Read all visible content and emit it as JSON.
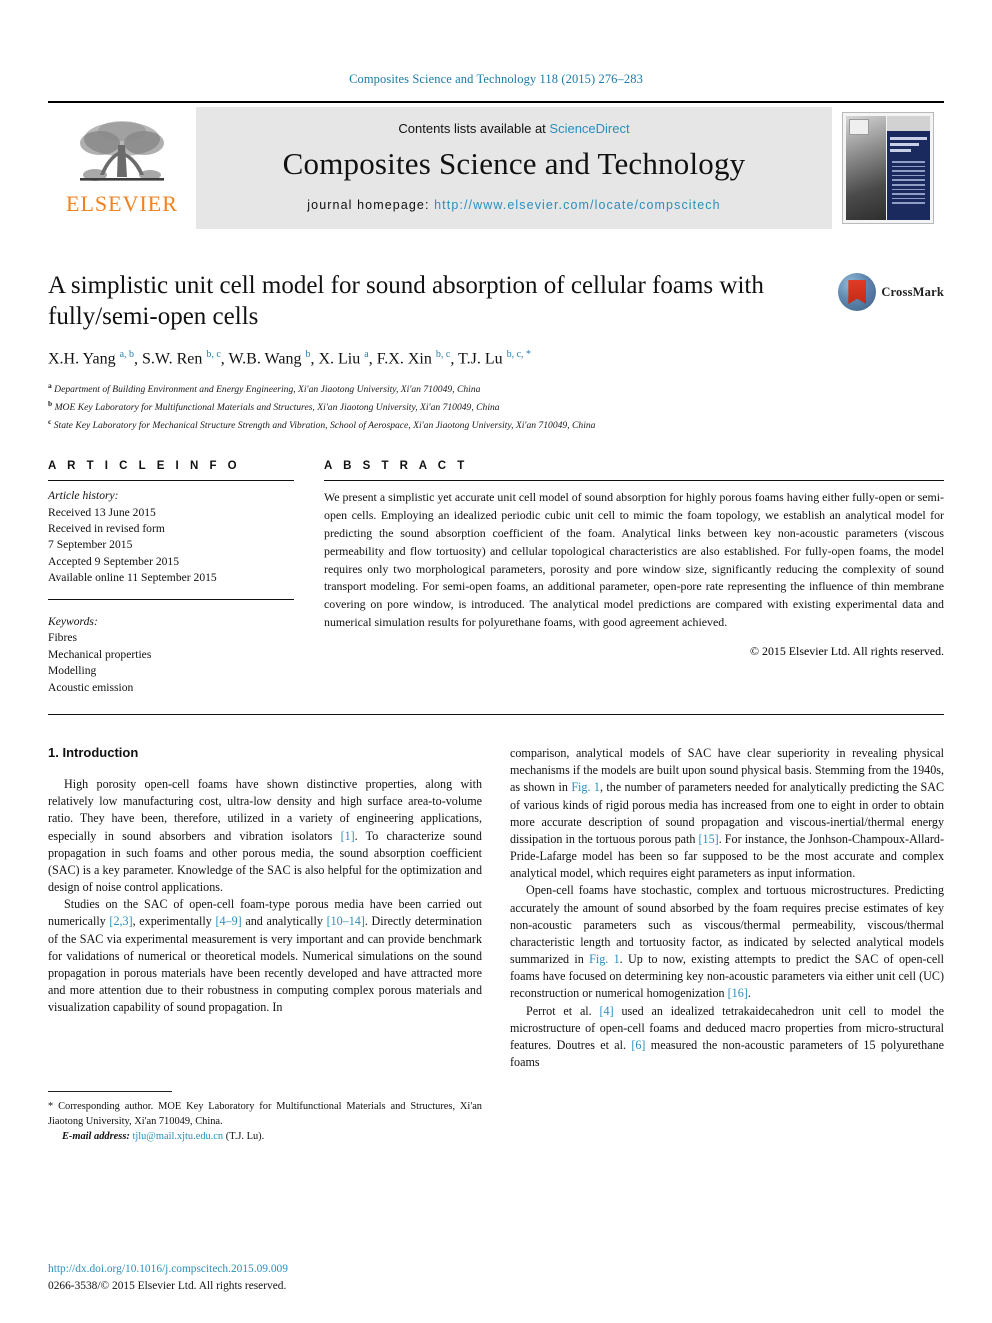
{
  "running_head": "Composites Science and Technology 118 (2015) 276–283",
  "masthead": {
    "contents_prefix": "Contents lists available at ",
    "sciencedirect": "ScienceDirect",
    "journal_name": "Composites Science and Technology",
    "homepage_label": "journal homepage: ",
    "homepage_url": "http://www.elsevier.com/locate/compscitech",
    "publisher": "ELSEVIER",
    "cover_title": "COMPOSITES SCIENCE AND TECHNOLOGY"
  },
  "article": {
    "title": "A simplistic unit cell model for sound absorption of cellular foams with fully/semi-open cells",
    "crossmark_label": "CrossMark",
    "authors_html": "X.H. Yang <sup>a, b</sup>, S.W. Ren <sup>b, c</sup>, W.B. Wang <sup>b</sup>, X. Liu <sup>a</sup>, F.X. Xin <sup>b, c</sup>, T.J. Lu <sup>b, c, *</sup>",
    "affiliations": [
      "Department of Building Environment and Energy Engineering, Xi'an Jiaotong University, Xi'an 710049, China",
      "MOE Key Laboratory for Multifunctional Materials and Structures, Xi'an Jiaotong University, Xi'an 710049, China",
      "State Key Laboratory for Mechanical Structure Strength and Vibration, School of Aerospace, Xi'an Jiaotong University, Xi'an 710049, China"
    ],
    "affiliation_marks": [
      "a",
      "b",
      "c"
    ]
  },
  "info": {
    "heading": "A R T I C L E   I N F O",
    "history_label": "Article history:",
    "history": [
      "Received 13 June 2015",
      "Received in revised form",
      "7 September 2015",
      "Accepted 9 September 2015",
      "Available online 11 September 2015"
    ],
    "keywords_label": "Keywords:",
    "keywords": [
      "Fibres",
      "Mechanical properties",
      "Modelling",
      "Acoustic emission"
    ]
  },
  "abstract": {
    "heading": "A B S T R A C T",
    "text": "We present a simplistic yet accurate unit cell model of sound absorption for highly porous foams having either fully-open or semi-open cells. Employing an idealized periodic cubic unit cell to mimic the foam topology, we establish an analytical model for predicting the sound absorption coefficient of the foam. Analytical links between key non-acoustic parameters (viscous permeability and flow tortuosity) and cellular topological characteristics are also established. For fully-open foams, the model requires only two morphological parameters, porosity and pore window size, significantly reducing the complexity of sound transport modeling. For semi-open foams, an additional parameter, open-pore rate representing the influence of thin membrane covering on pore window, is introduced. The analytical model predictions are compared with existing experimental data and numerical simulation results for polyurethane foams, with good agreement achieved.",
    "copyright": "© 2015 Elsevier Ltd. All rights reserved."
  },
  "body": {
    "section_title": "1. Introduction",
    "left_paragraphs": [
      {
        "segments": [
          {
            "t": "High porosity open-cell foams have shown distinctive properties, along with relatively low manufacturing cost, ultra-low density and high surface area-to-volume ratio. They have been, therefore, utilized in a variety of engineering applications, especially in sound absorbers and vibration isolators "
          },
          {
            "t": "[1]",
            "ref": true
          },
          {
            "t": ". To characterize sound propagation in such foams and other porous media, the sound absorption coefficient (SAC) is a key parameter. Knowledge of the SAC is also helpful for the optimization and design of noise control applications."
          }
        ]
      },
      {
        "segments": [
          {
            "t": "Studies on the SAC of open-cell foam-type porous media have been carried out numerically "
          },
          {
            "t": "[2,3]",
            "ref": true
          },
          {
            "t": ", experimentally "
          },
          {
            "t": "[4–9]",
            "ref": true
          },
          {
            "t": " and analytically "
          },
          {
            "t": "[10–14]",
            "ref": true
          },
          {
            "t": ". Directly determination of the SAC via experimental measurement is very important and can provide benchmark for validations of numerical or theoretical models. Numerical simulations on the sound propagation in porous materials have been recently developed and have attracted more and more attention due to their robustness in computing complex porous materials and visualization capability of sound propagation. In"
          }
        ]
      }
    ],
    "right_paragraphs": [
      {
        "noindent": true,
        "segments": [
          {
            "t": "comparison, analytical models of SAC have clear superiority in revealing physical mechanisms if the models are built upon sound physical basis. Stemming from the 1940s, as shown in "
          },
          {
            "t": "Fig. 1",
            "ref": true
          },
          {
            "t": ", the number of parameters needed for analytically predicting the SAC of various kinds of rigid porous media has increased from one to eight in order to obtain more accurate description of sound propagation and viscous-inertial/thermal energy dissipation in the tortuous porous path "
          },
          {
            "t": "[15]",
            "ref": true
          },
          {
            "t": ". For instance, the Jonhson-Champoux-Allard-Pride-Lafarge model has been so far supposed to be the most accurate and complex analytical model, which requires eight parameters as input information."
          }
        ]
      },
      {
        "segments": [
          {
            "t": "Open-cell foams have stochastic, complex and tortuous microstructures. Predicting accurately the amount of sound absorbed by the foam requires precise estimates of key non-acoustic parameters such as viscous/thermal permeability, viscous/thermal characteristic length and tortuosity factor, as indicated by selected analytical models summarized in "
          },
          {
            "t": "Fig. 1",
            "ref": true
          },
          {
            "t": ". Up to now, existing attempts to predict the SAC of open-cell foams have focused on determining key non-acoustic parameters via either unit cell (UC) reconstruction or numerical homogenization "
          },
          {
            "t": "[16]",
            "ref": true
          },
          {
            "t": "."
          }
        ]
      },
      {
        "segments": [
          {
            "t": "Perrot et al. "
          },
          {
            "t": "[4]",
            "ref": true
          },
          {
            "t": " used an idealized tetrakaidecahedron unit cell to model the microstructure of open-cell foams and deduced macro properties from micro-structural features. Doutres et al. "
          },
          {
            "t": "[6]",
            "ref": true
          },
          {
            "t": " measured the non-acoustic parameters of 15 polyurethane foams"
          }
        ]
      }
    ]
  },
  "footnote": {
    "star": "*",
    "corresponding": " Corresponding author. MOE Key Laboratory for Multifunctional Materials and Structures, Xi'an Jiaotong University, Xi'an 710049, China.",
    "email_label": "E-mail address:",
    "email": "tjlu@mail.xjtu.edu.cn",
    "email_owner": "(T.J. Lu)."
  },
  "footer": {
    "doi": "http://dx.doi.org/10.1016/j.compscitech.2015.09.009",
    "issn": "0266-3538/© 2015 Elsevier Ltd. All rights reserved."
  },
  "colors": {
    "link": "#2a8fbd",
    "runhead": "#1a7ba8",
    "elsevier_orange": "#F08221",
    "masthead_bg": "#e6e6e6",
    "crossmark_red": "#d3351c",
    "cover_navy": "#1b2a5e"
  }
}
